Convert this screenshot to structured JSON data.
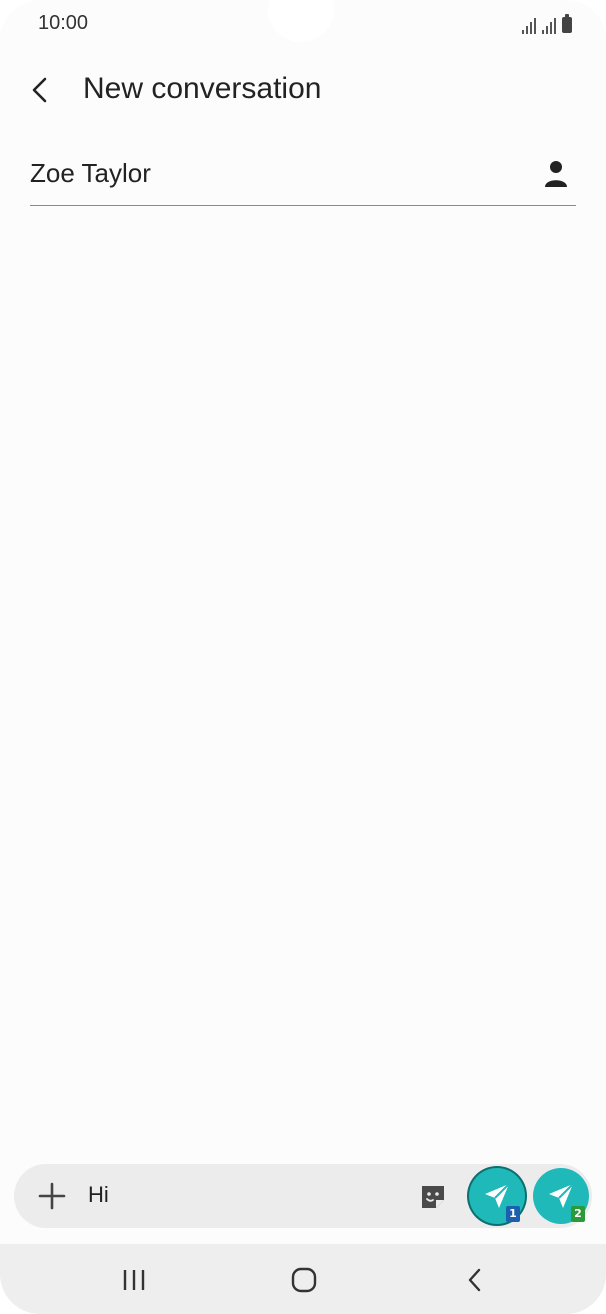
{
  "status_bar": {
    "time": "10:00",
    "icons": [
      "signal-sim1-icon",
      "signal-sim2-icon",
      "battery-icon"
    ]
  },
  "header": {
    "back_icon": "back-arrow-icon",
    "title": "New conversation"
  },
  "recipient": {
    "name": "Zoe Taylor",
    "contact_icon": "person-icon"
  },
  "compose": {
    "add_icon": "plus-icon",
    "message_value": "Hi",
    "sticker_icon": "sticker-icon",
    "send_buttons": [
      {
        "icon": "send-icon",
        "sim_label": "1",
        "badge_color": "#1c5fae"
      },
      {
        "icon": "send-icon",
        "sim_label": "2",
        "badge_color": "#2b9a3a"
      }
    ],
    "accent_color": "#1fb9b9"
  },
  "nav_bar": {
    "items": [
      "recents-icon",
      "home-icon",
      "back-icon"
    ]
  }
}
